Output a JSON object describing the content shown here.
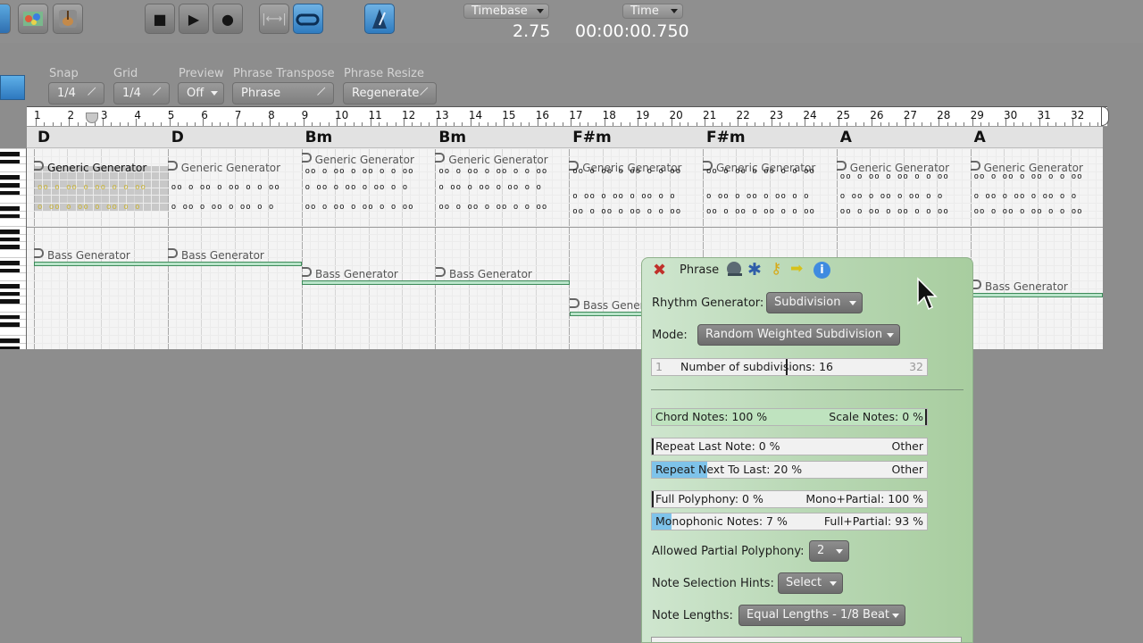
{
  "toolbar": {
    "timebase_label": "Timebase",
    "timebase_value": "2.75",
    "time_label": "Time",
    "time_value": "00:00:00.750",
    "transport": [
      "stop",
      "play",
      "record"
    ]
  },
  "controls": [
    {
      "label": "Snap",
      "value": "1/4"
    },
    {
      "label": "Grid",
      "value": "1/4"
    },
    {
      "label": "Preview",
      "value": "Off"
    },
    {
      "label": "Phrase Transpose",
      "value": "Phrase"
    },
    {
      "label": "Phrase Resize",
      "value": "Regenerate"
    }
  ],
  "ruler": {
    "bars": [
      "1",
      "2",
      "3",
      "4",
      "5",
      "6",
      "7",
      "8",
      "9",
      "10",
      "11",
      "12",
      "13",
      "14",
      "15",
      "16",
      "17",
      "18",
      "19",
      "20",
      "21",
      "22",
      "23",
      "24",
      "25",
      "26",
      "27",
      "28",
      "29",
      "30",
      "31",
      "32"
    ]
  },
  "chords": [
    "D",
    "D",
    "Bm",
    "Bm",
    "F#m",
    "F#m",
    "A",
    "A"
  ],
  "tracks": {
    "generic": [
      "Generic Generator",
      "Generic Generator",
      "Generic Generator",
      "Generic Generator",
      "Generic Generator",
      "Generic Generator",
      "Generic Generator",
      "Generic Generator"
    ],
    "bass": [
      "Bass Generator",
      "Bass Generator",
      "Bass Generator",
      "Bass Generator",
      "Bass Generator",
      "Bass Generator"
    ]
  },
  "panel": {
    "title": "Phrase",
    "icons": [
      "close-icon",
      "wrench-icon",
      "gear-icon",
      "key-icon",
      "arrow-icon",
      "info-icon"
    ],
    "rhythm_generator_label": "Rhythm Generator:",
    "rhythm_generator_value": "Subdivision",
    "mode_label": "Mode:",
    "mode_value": "Random Weighted Subdivision",
    "subdiv_min": "1",
    "subdiv_text": "Number of subdivisions: 16",
    "subdiv_max": "32",
    "subdiv_value": 16,
    "chord_notes": "Chord Notes: 100 %",
    "scale_notes": "Scale Notes: 0 %",
    "repeat_last": "Repeat Last Note: 0 %",
    "repeat_last_other": "Other",
    "repeat_next": "Repeat Next To Last: 20 %",
    "repeat_next_other": "Other",
    "repeat_next_percent": 20,
    "full_poly": "Full Polyphony: 0 %",
    "mono_partial": "Mono+Partial: 100 %",
    "mono_notes": "Monophonic Notes: 7 %",
    "full_partial": "Full+Partial: 93 %",
    "mono_percent": 7,
    "partial_poly_label": "Allowed Partial Polyphony:",
    "partial_poly_value": "2",
    "note_hints_label": "Note Selection Hints:",
    "note_hints_value": "Select",
    "note_lengths_label": "Note Lengths:",
    "note_lengths_value": "Equal Lengths - 1/8 Beat"
  },
  "colors": {
    "panel_green": "#b9d8b5",
    "slider_blue": "#7ec3ea",
    "accent_blue": "#2f7cc0"
  }
}
